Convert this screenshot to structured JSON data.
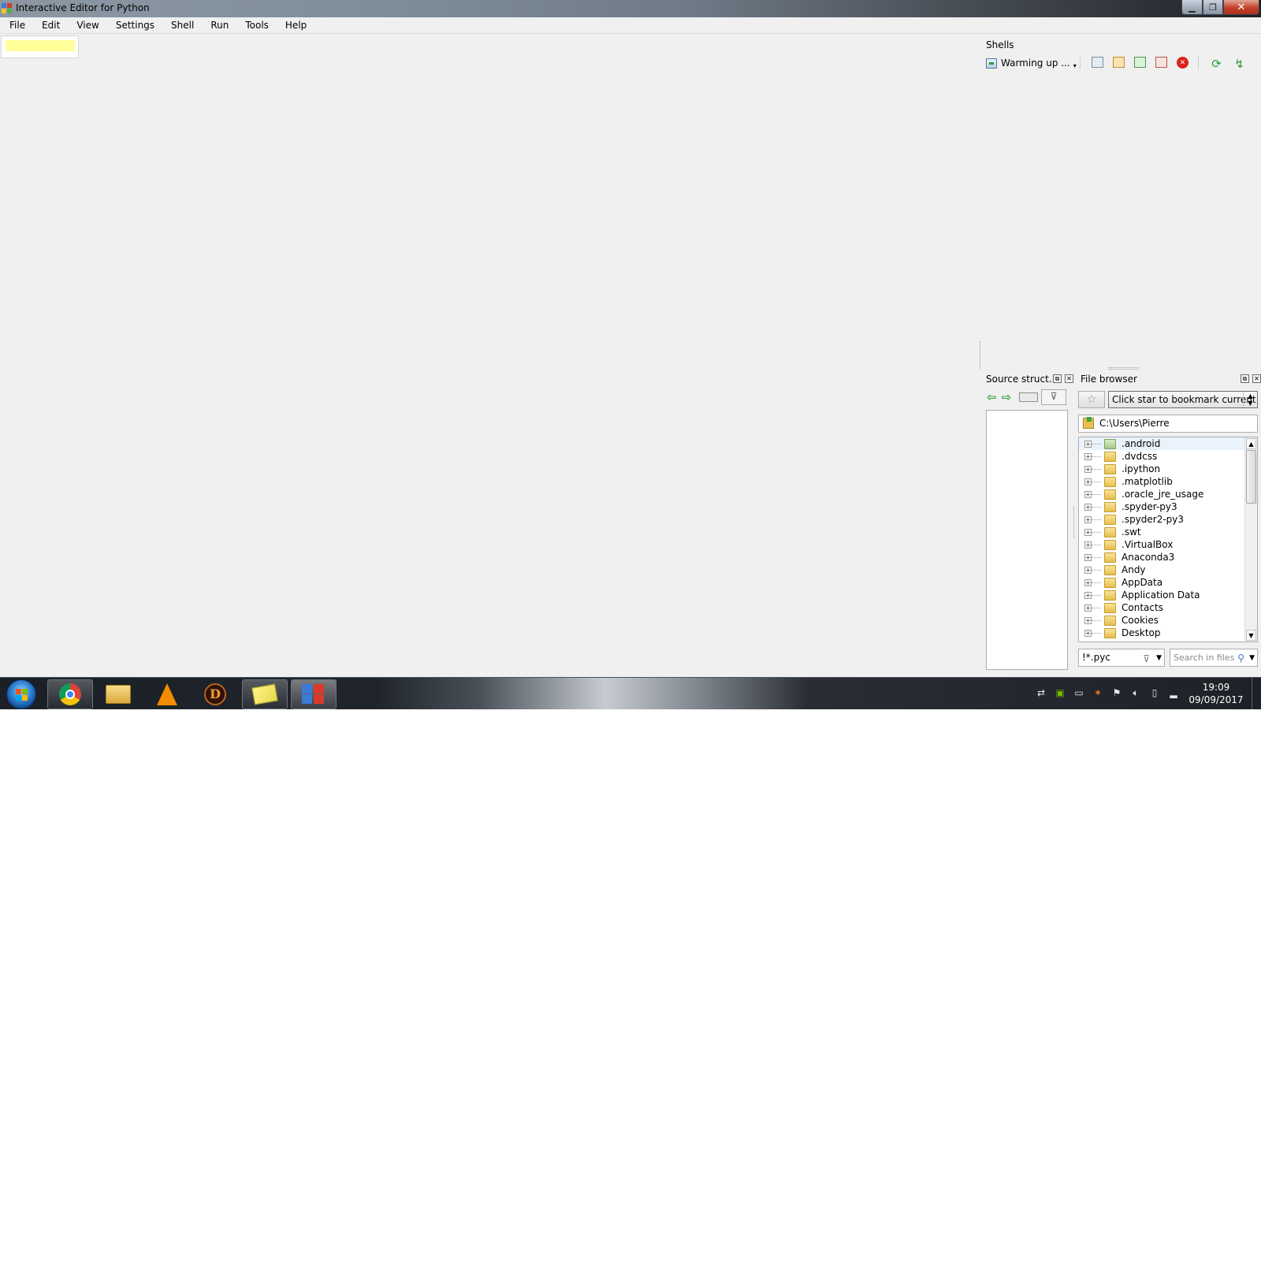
{
  "window": {
    "title": "Interactive Editor for Python",
    "min_glyph": "▁",
    "max_glyph": "❐",
    "close_glyph": "✕"
  },
  "menu": {
    "items": [
      "File",
      "Edit",
      "View",
      "Settings",
      "Shell",
      "Run",
      "Tools",
      "Help"
    ]
  },
  "shells": {
    "title": "Shells",
    "current_shell": "Warming up ...",
    "dropdown_glyph": "▾",
    "more_glyph": "»",
    "icons": [
      "new-shell-icon",
      "interrupt-icon",
      "restart-icon",
      "clear-icon",
      "terminate-icon",
      "run-icon",
      "debug-icon"
    ]
  },
  "source_structure": {
    "title": "Source struct...",
    "undock_glyph": "⧉",
    "close_glyph": "✕",
    "back_glyph": "⇦",
    "forward_glyph": "⇨",
    "filter_glyph": "⊽"
  },
  "file_browser": {
    "title": "File browser",
    "undock_glyph": "⧉",
    "close_glyph": "✕",
    "star_glyph": "☆",
    "bookmark_placeholder": "Click star to bookmark current dir",
    "path": "C:\\Users\\Pierre",
    "items": [
      ".android",
      ".dvdcss",
      ".ipython",
      ".matplotlib",
      ".oracle_jre_usage",
      ".spyder-py3",
      ".spyder2-py3",
      ".swt",
      ".VirtualBox",
      "Anaconda3",
      "Andy",
      "AppData",
      "Application Data",
      "Contacts",
      "Cookies",
      "Desktop"
    ],
    "filter_value": "!*.pyc",
    "search_placeholder": "Search in files",
    "scroll_up_glyph": "▲",
    "scroll_down_glyph": "▼",
    "expand_glyph": "+"
  },
  "taskbar": {
    "time": "19:09",
    "date": "09/09/2017",
    "apps": [
      "chrome",
      "explorer",
      "vlc",
      "diablo-3",
      "sticky-notes",
      "iep"
    ],
    "d3_letter": "D"
  },
  "colors": {
    "editor_tab_highlight": "#ffff99",
    "close_red": "#c4402a",
    "run_green": "#2e9b33"
  }
}
